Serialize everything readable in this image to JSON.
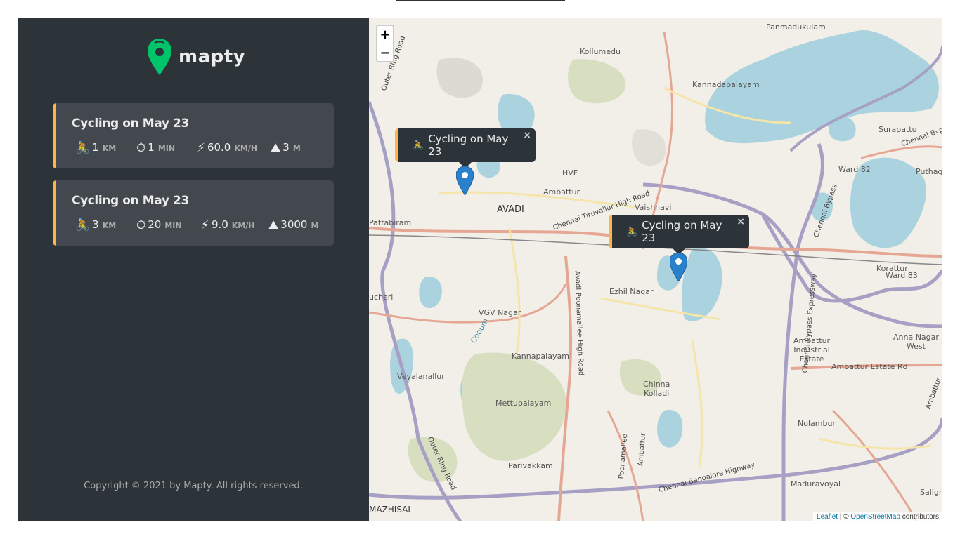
{
  "sidebar": {
    "logo_text": "mapty",
    "workouts": [
      {
        "title": "Cycling on May 23",
        "type_icon": "🚴",
        "distance": "1",
        "distance_unit": "km",
        "duration": "1",
        "duration_unit": "min",
        "speed": "60.0",
        "speed_unit": "km/h",
        "elevation": "3",
        "elevation_unit": "m"
      },
      {
        "title": "Cycling on May 23",
        "type_icon": "🚴",
        "distance": "3",
        "distance_unit": "km",
        "duration": "20",
        "duration_unit": "min",
        "speed": "9.0",
        "speed_unit": "km/h",
        "elevation": "3000",
        "elevation_unit": "m"
      }
    ],
    "icons": {
      "duration": "⏱",
      "speed": "⚡",
      "elevation": "⛰"
    },
    "copyright": "Copyright © 2021 by Mapty. All rights reserved."
  },
  "map": {
    "zoom_in": "+",
    "zoom_out": "−",
    "popups": [
      {
        "icon": "🚴",
        "text": "Cycling on May 23",
        "close": "×"
      },
      {
        "icon": "🚴",
        "text": "Cycling on May 23",
        "close": "×"
      }
    ],
    "places": {
      "panmadukulam": "Panmadukulam",
      "kollumedu": "Kollumedu",
      "kannadapalayam": "Kannadapalayam",
      "surapattu": "Surapattu",
      "ward82": "Ward 82",
      "puthagaram": "Puthaga",
      "hvf": "HVF",
      "ambattur1": "Ambattur",
      "avadi": "AVADI",
      "vaishnavi": "Vaishnavi",
      "pattabiram": "Pattabiram",
      "korattur": "Korattur",
      "ward83": "Ward 83",
      "ezhil_nagar": "Ezhil Nagar",
      "vgv_nagar": "VGV Nagar",
      "coum": "Cooum",
      "tucheri": "ucheri",
      "kannapalayam": "Kannapalayam",
      "ambattur_industrial": "Ambattur\nIndustrial\nEstate",
      "anna_nagar_west": "Anna Nagar\nWest",
      "veyalanallur": "Veyalanallur",
      "mettupalayam": "Mettupalayam",
      "chinna_kolladi": "Chinna\nKolladi",
      "nolambur": "Nolambur",
      "parivakkam": "Parivakkam",
      "maduravoyal": "Maduravoyal",
      "saligramam": "Saligra",
      "mazhisai": "MAZHISAI"
    },
    "roads": {
      "outer_ring": "Outer Ring Road",
      "chennai_tiruvallur": "Chennai Tiruvallur High Road",
      "chennai_bypass": "Chennai Bypass",
      "chennai_bypass_expressway": "Chennai Bypass Expressway",
      "avadi_poonamallee": "Avadi-Poonamallee High Road",
      "ambattur_estate_rd": "Ambattur Estate Rd",
      "chennai_bangalore": "Chennai Bangalore Highway",
      "poonamallee": "Poonamallee",
      "ambattur_road": "Ambattur",
      "chennai_bypass_ne": "Chennai Byp",
      "ambattur_ne": "Ambattur"
    },
    "attribution": {
      "leaflet": "Leaflet",
      "separator": " | © ",
      "osm": "OpenStreetMap",
      "suffix": " contributors"
    },
    "colors": {
      "water": "#aad3df",
      "park": "#d8dfc0",
      "major_road": "#e6a694",
      "motorway": "#a6a0c4",
      "secondary": "#f5e5a8",
      "accent": "#ffb545",
      "marker": "#2a81cb"
    }
  }
}
